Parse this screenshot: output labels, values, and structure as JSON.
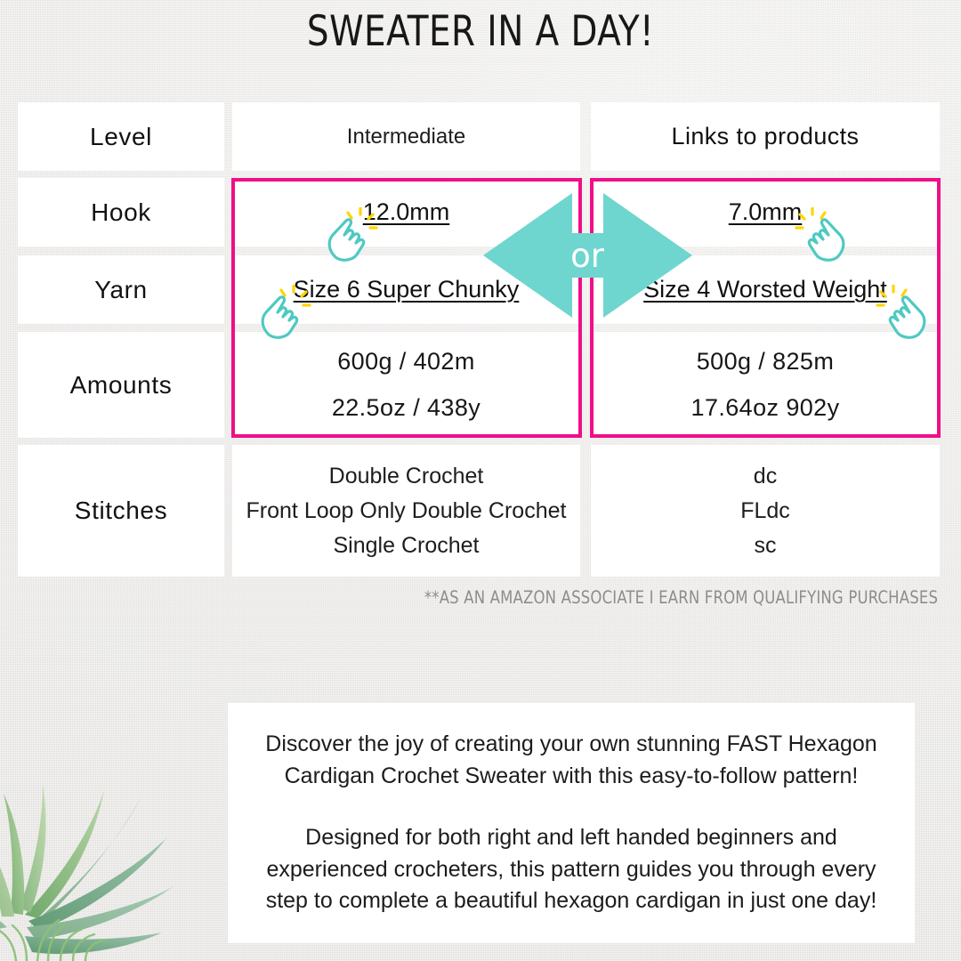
{
  "title": "SWEATER IN A DAY!",
  "colors": {
    "pink": "#ef0f88",
    "teal": "#6ed6ce",
    "background": "#ececea",
    "card": "#ffffff",
    "text": "#171717",
    "muted": "#8d8d8d",
    "sparkle": "#ffd400"
  },
  "table": {
    "rows": [
      {
        "label": "Level",
        "middle": "Intermediate",
        "right": "Links to products"
      },
      {
        "label": "Hook",
        "middle": "12.0mm",
        "right": "7.0mm"
      },
      {
        "label": "Yarn",
        "middle": "Size 6 Super Chunky",
        "right": "Size 4 Worsted Weight"
      },
      {
        "label": "Amounts",
        "middle": [
          "600g / 402m",
          "22.5oz / 438y"
        ],
        "right": [
          "500g  /  825m",
          "17.64oz  902y"
        ]
      },
      {
        "label": "Stitches",
        "middle": [
          "Double Crochet",
          "Front Loop Only Double Crochet",
          "Single Crochet"
        ],
        "right": [
          "dc",
          "FLdc",
          "sc"
        ]
      }
    ]
  },
  "or_badge": "or",
  "disclaimer": "**AS AN AMAZON ASSOCIATE I EARN FROM QUALIFYING PURCHASES",
  "description": {
    "paragraph1": "Discover the joy of creating your own stunning FAST Hexagon Cardigan Crochet Sweater with this easy-to-follow pattern!",
    "paragraph2": "Designed for both right and left handed beginners and experienced crocheters, this pattern guides you through every step to complete a beautiful hexagon cardigan in just one day!"
  }
}
